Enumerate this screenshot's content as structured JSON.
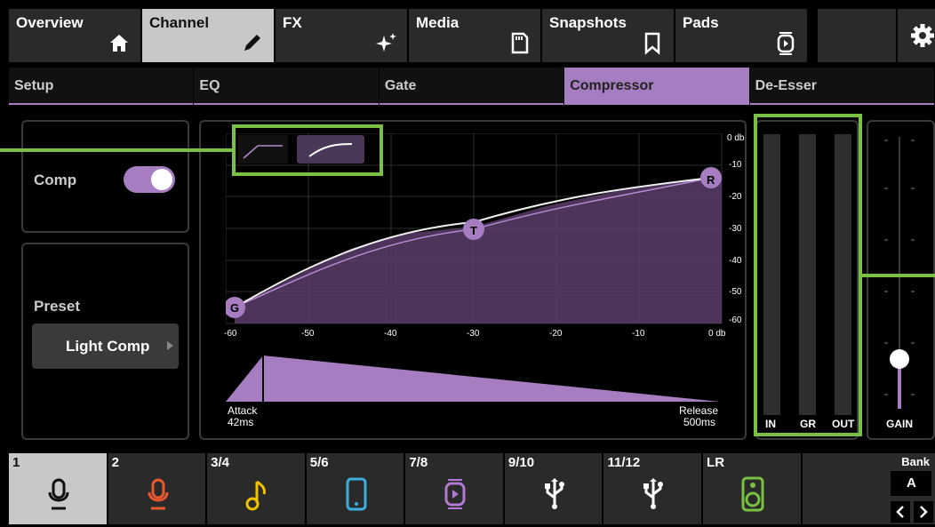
{
  "tabs": [
    {
      "label": "Overview",
      "icon": "home-icon"
    },
    {
      "label": "Channel",
      "icon": "pencil-icon"
    },
    {
      "label": "FX",
      "icon": "sparkle-icon"
    },
    {
      "label": "Media",
      "icon": "sd-card-icon"
    },
    {
      "label": "Snapshots",
      "icon": "bookmark-icon"
    },
    {
      "label": "Pads",
      "icon": "pad-play-icon"
    }
  ],
  "subtabs": [
    "Setup",
    "EQ",
    "Gate",
    "Compressor",
    "De-Esser"
  ],
  "comp": {
    "label": "Comp",
    "enabled": true
  },
  "preset": {
    "label": "Preset",
    "value": "Light Comp"
  },
  "graph": {
    "db_right": [
      "0 db",
      "-10",
      "-20",
      "-30",
      "-40",
      "-50",
      "-60"
    ],
    "db_bottom": [
      "-60",
      "-50",
      "-40",
      "-30",
      "-20",
      "-10",
      "0 db"
    ],
    "markers": {
      "gate": "G",
      "threshold": "T",
      "ratio": "R"
    },
    "attack_label": "Attack",
    "attack_value": "42ms",
    "release_label": "Release",
    "release_value": "500ms"
  },
  "meters": {
    "in": "IN",
    "gr": "GR",
    "out": "OUT",
    "gain": "GAIN",
    "gain_level": 0.2
  },
  "channels": [
    {
      "num": "1",
      "color": "#111111",
      "icon": "microphone-icon"
    },
    {
      "num": "2",
      "color": "#e8582c",
      "icon": "microphone-icon"
    },
    {
      "num": "3/4",
      "color": "#f2c200",
      "icon": "music-note-icon"
    },
    {
      "num": "5/6",
      "color": "#3ab0e0",
      "icon": "phone-icon"
    },
    {
      "num": "7/8",
      "color": "#b07ad0",
      "icon": "pad-play-icon"
    },
    {
      "num": "9/10",
      "color": "#ffffff",
      "icon": "usb-icon"
    },
    {
      "num": "11/12",
      "color": "#ffffff",
      "icon": "usb-icon"
    },
    {
      "num": "LR",
      "color": "#7ac143",
      "icon": "speaker-icon"
    }
  ],
  "bank": {
    "label": "Bank",
    "value": "A"
  }
}
